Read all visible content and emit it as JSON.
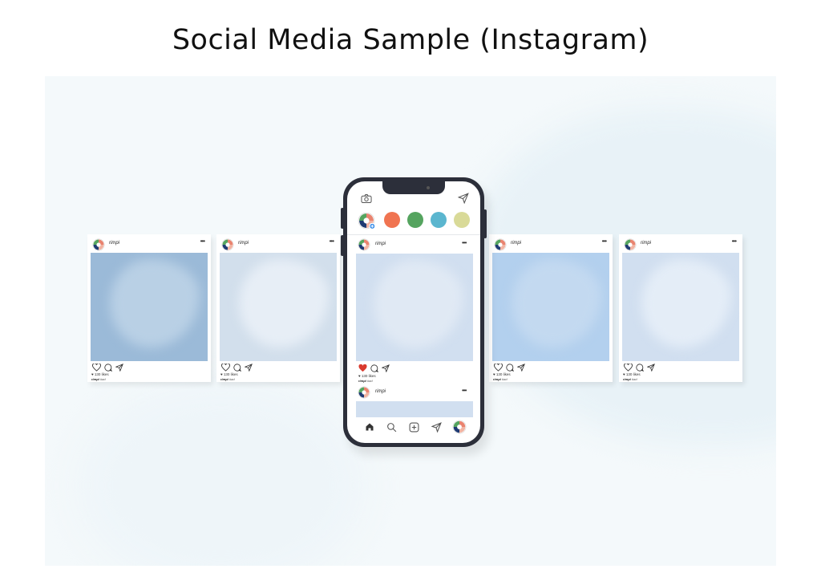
{
  "title": "Social Media Sample (Instagram)",
  "colors": {
    "phone": "#2c2f3a",
    "heart": "#d93a2e",
    "story_colors": [
      "#f07451",
      "#55a45f",
      "#5bb6cf",
      "#d9da98"
    ]
  },
  "icons": {
    "camera": "camera-icon",
    "send": "send-icon",
    "more": "more-icon",
    "heart": "heart-icon",
    "comment": "comment-icon",
    "home": "home-icon",
    "search": "search-icon",
    "add": "add-post-icon"
  },
  "post_common": {
    "username": "rimpi",
    "more": "•••",
    "likes": "♥ 130 likes",
    "caption_user": "rimpi",
    "caption_text": "#ad"
  },
  "posts": [
    {
      "image_bg": "#9bbad8",
      "shape": "#b9d0e5"
    },
    {
      "image_bg": "#d2dfec",
      "shape": "#e5edf5"
    },
    {
      "image_bg": "#b3d0ee",
      "shape": "#c3d9f0"
    },
    {
      "image_bg": "#d1dff0",
      "shape": "#e4edf7"
    }
  ],
  "phone": {
    "feed_user": "rimpi",
    "feed_more": "•••",
    "feed_likes": "♥ 130 likes",
    "feed_caption_user": "rimpi",
    "feed_caption_text": "#ad",
    "second_user": "rimpi",
    "second_more": "•••"
  }
}
